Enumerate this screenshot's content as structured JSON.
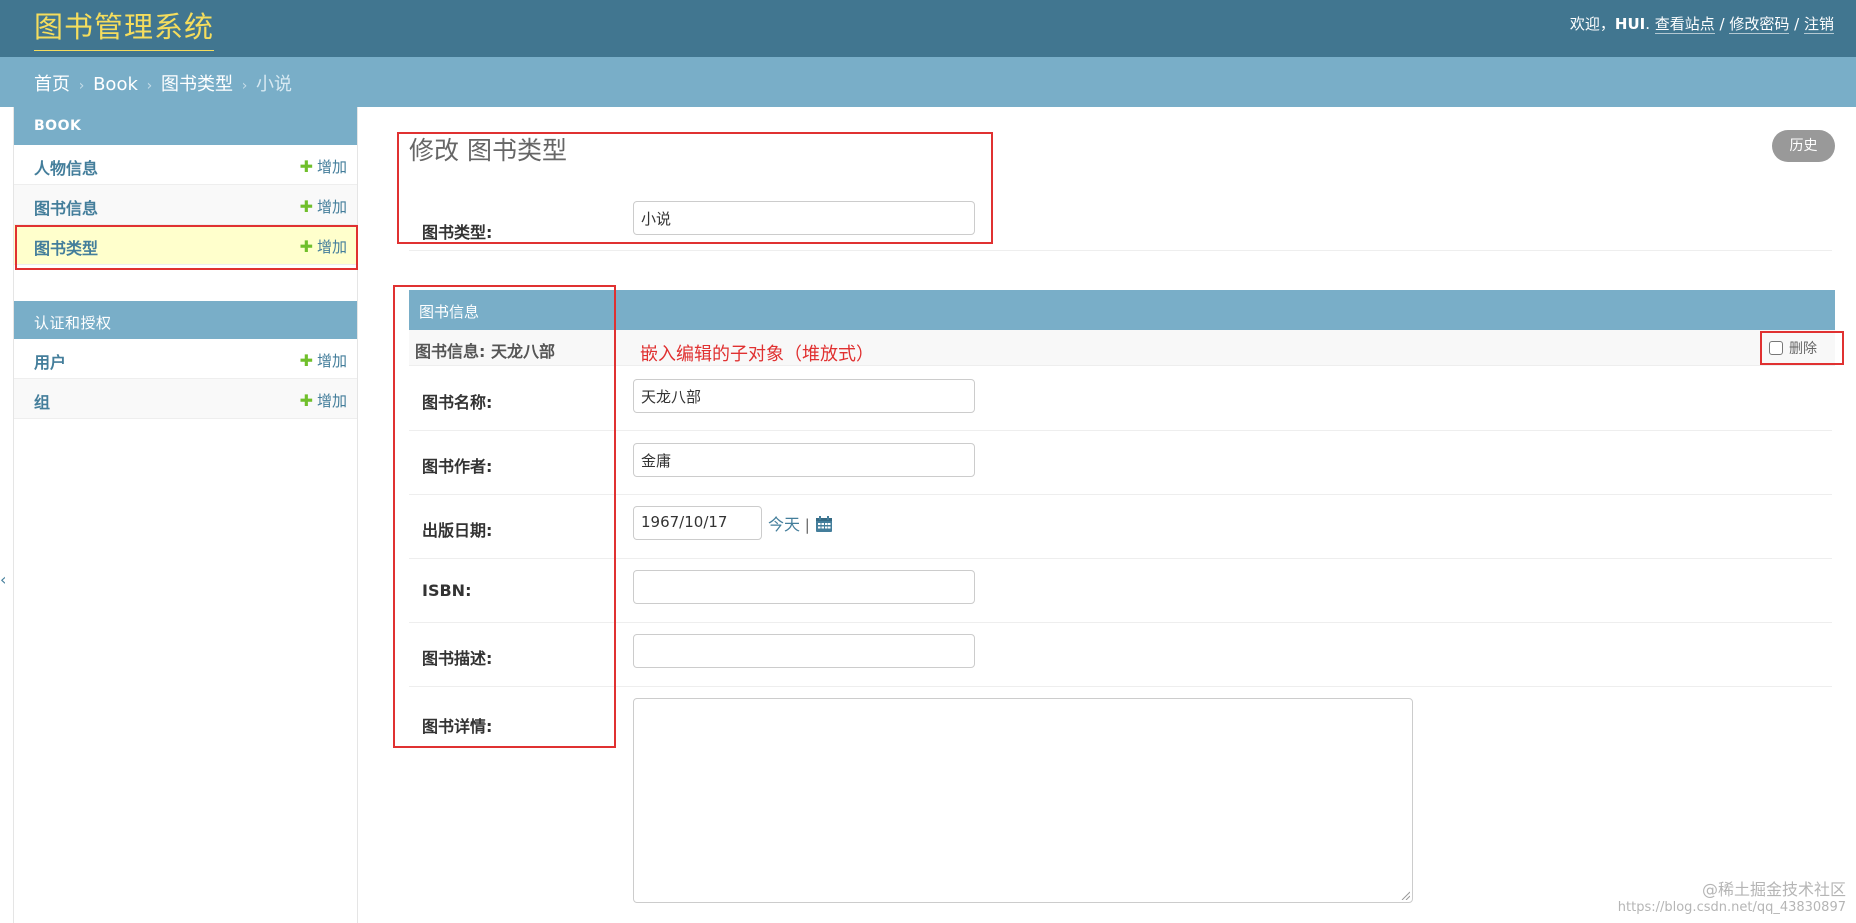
{
  "header": {
    "site_title": "图书管理系统",
    "welcome": "欢迎，",
    "username": "HUI",
    "view_site": "查看站点",
    "change_password": "修改密码",
    "logout": "注销",
    "sep": " / "
  },
  "breadcrumbs": {
    "home": "首页",
    "app": "Book",
    "model": "图书类型",
    "current": "小说"
  },
  "sidebar": {
    "modules": [
      {
        "caption": "BOOK",
        "items": [
          {
            "label": "人物信息",
            "add": "增加"
          },
          {
            "label": "图书信息",
            "add": "增加"
          },
          {
            "label": "图书类型",
            "add": "增加"
          }
        ]
      },
      {
        "caption": "认证和授权",
        "items": [
          {
            "label": "用户",
            "add": "增加"
          },
          {
            "label": "组",
            "add": "增加"
          }
        ]
      }
    ]
  },
  "main": {
    "title": "修改 图书类型",
    "history": "历史",
    "type_field": {
      "label": "图书类型:",
      "value": "小说"
    },
    "inline": {
      "header": "图书信息",
      "object_title": "图书信息: 天龙八部",
      "annotation": "嵌入编辑的子对象（堆放式）",
      "delete_label": "删除",
      "fields": {
        "name": {
          "label": "图书名称:",
          "value": "天龙八部"
        },
        "author": {
          "label": "图书作者:",
          "value": "金庸"
        },
        "pub_date": {
          "label": "出版日期:",
          "value": "1967/10/17",
          "today": "今天",
          "pipe": " | "
        },
        "isbn": {
          "label": "ISBN:",
          "value": ""
        },
        "desc": {
          "label": "图书描述:",
          "value": ""
        },
        "detail": {
          "label": "图书详情:",
          "value": ""
        }
      }
    }
  },
  "watermark": {
    "line1": "@稀土掘金技术社区",
    "line2": "https://blog.csdn.net/qq_43830897"
  },
  "colors": {
    "header": "#417690",
    "breadcrumb": "#79aec8",
    "title_yellow": "#f5dd5d",
    "link": "#447e9b",
    "add_green": "#70bf2b",
    "annotation_red": "#e03131"
  }
}
